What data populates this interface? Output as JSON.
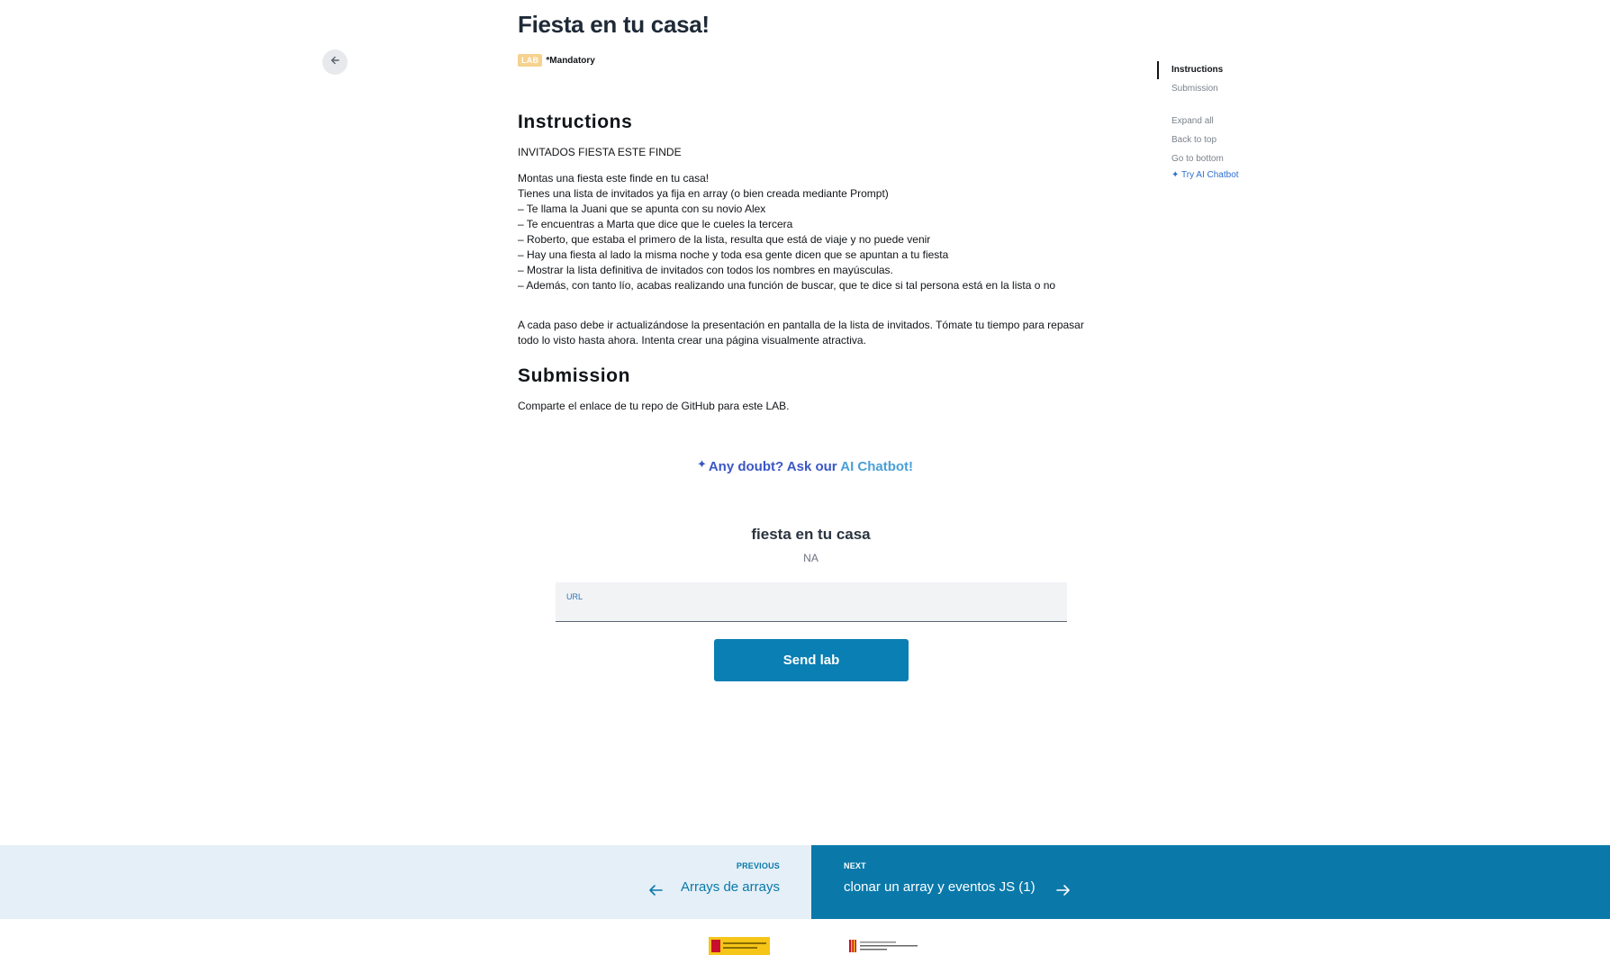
{
  "header": {
    "title": "Fiesta en tu casa!",
    "badge": "LAB",
    "mandatory": "*Mandatory",
    "back_icon": "arrow-left-icon"
  },
  "instructions": {
    "heading": "Instructions",
    "subtitle": "INVITADOS FIESTA ESTE FINDE",
    "lines": [
      "Montas una fiesta este finde en tu casa!",
      "Tienes una lista de invitados ya fija en array (o bien creada mediante Prompt)",
      "– Te llama la Juani que se apunta con su novio Alex",
      "– Te encuentras a Marta que dice que le cueles la tercera",
      "– Roberto, que estaba el primero de la lista, resulta que está de viaje y no puede venir",
      "– Hay una fiesta al lado la misma noche y toda esa gente dicen que se apuntan a tu fiesta",
      "– Mostrar la lista definitiva de invitados con todos los nombres en mayúsculas.",
      "– Además, con tanto lío, acabas realizando una función de buscar, que te dice si tal persona está en la lista o no"
    ],
    "closing": "A cada paso debe ir actualizándose la presentación en pantalla de la lista de invitados. Tómate tu tiempo para repasar todo lo visto hasta ahora. Intenta crear una página visualmente atractiva."
  },
  "submission": {
    "heading": "Submission",
    "text": "Comparte el enlace de tu repo de GitHub para este LAB."
  },
  "ai_cta": {
    "prefix": "Any doubt? Ask our ",
    "highlight": "AI Chatbot!"
  },
  "form": {
    "title": "fiesta en tu casa",
    "grade": "NA",
    "url_label": "URL",
    "url_value": "",
    "submit_label": "Send lab"
  },
  "toc": {
    "items": [
      "Instructions",
      "Submission"
    ],
    "actions": [
      "Expand all",
      "Back to top",
      "Go to bottom"
    ],
    "chatbot": "Try AI Chatbot"
  },
  "pagination": {
    "prev_label": "PREVIOUS",
    "prev_title": "Arrays de arrays",
    "next_label": "NEXT",
    "next_title": "clonar un array y eventos JS (1)"
  },
  "colors": {
    "primary": "#0a7fb3",
    "accent": "#3a57c4",
    "badge": "#f6d28f"
  }
}
